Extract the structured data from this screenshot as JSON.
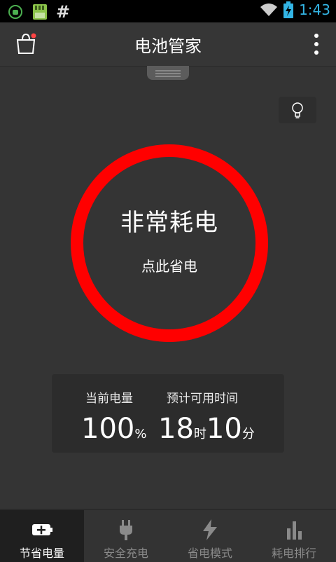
{
  "statusbar": {
    "time": "1:43",
    "hash_symbol": "#",
    "icons": [
      "android-debug-icon",
      "sd-card-icon",
      "wifi-icon",
      "battery-charging-icon"
    ]
  },
  "header": {
    "title": "电池管家",
    "icons": [
      "shopping-bag-icon",
      "overflow-menu-icon"
    ]
  },
  "tip_button": {
    "icon": "lightbulb-icon"
  },
  "ring": {
    "status": "非常耗电",
    "action": "点此省电",
    "color": "#ff0000"
  },
  "battery_info": {
    "current_label": "当前电量",
    "current_value": "100",
    "current_unit": "%",
    "remaining_label": "预计可用时间",
    "hours": "18",
    "hours_unit": "时",
    "minutes": "10",
    "minutes_unit": "分"
  },
  "nav": {
    "tabs": [
      {
        "label": "节省电量",
        "icon": "battery-plus-icon",
        "active": true
      },
      {
        "label": "安全充电",
        "icon": "plug-icon",
        "active": false
      },
      {
        "label": "省电模式",
        "icon": "lightning-icon",
        "active": false
      },
      {
        "label": "耗电排行",
        "icon": "bar-chart-icon",
        "active": false
      }
    ]
  },
  "colors": {
    "accent_status_time": "#33b5e5",
    "ring": "#ff0000",
    "background": "#343434"
  }
}
